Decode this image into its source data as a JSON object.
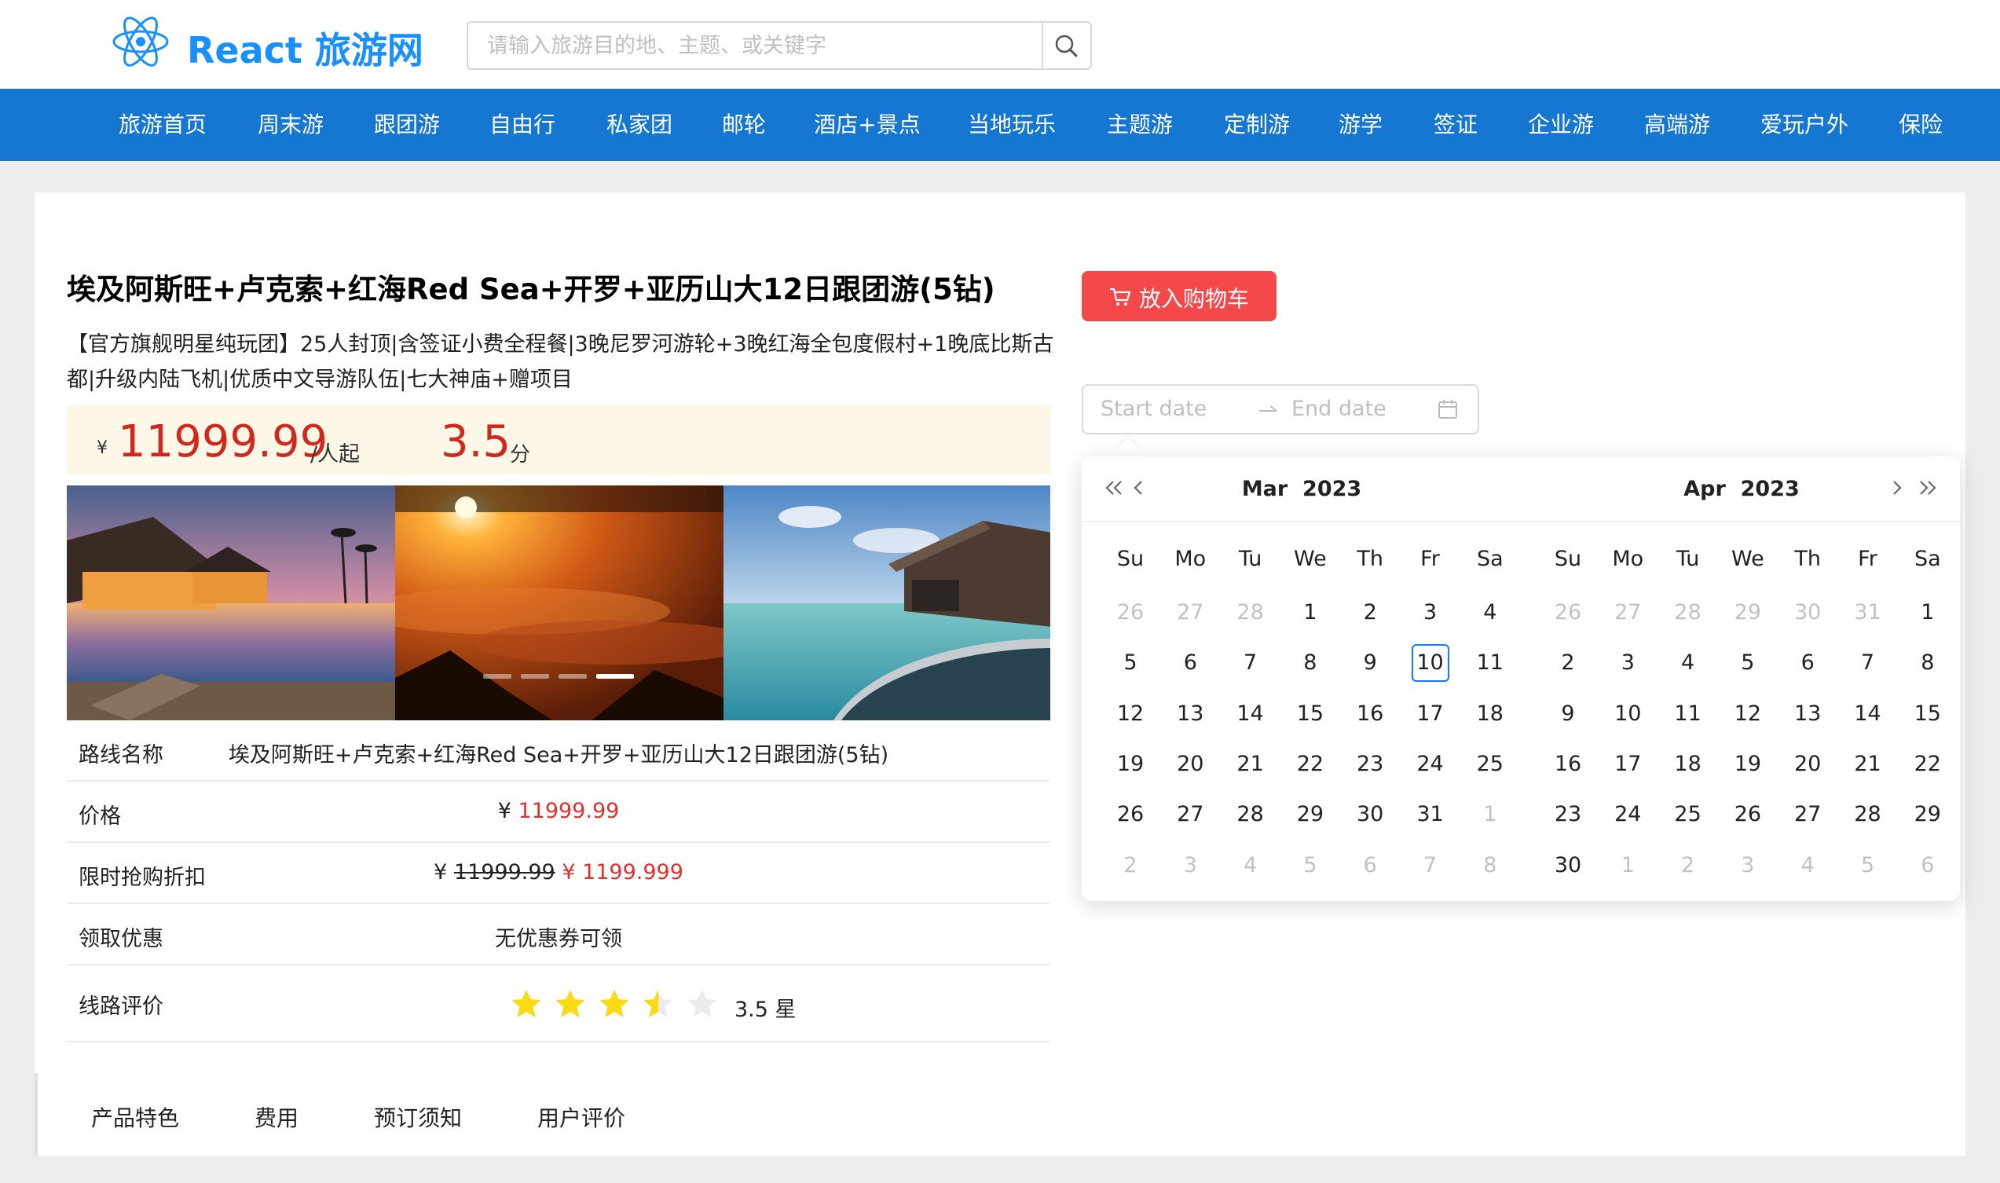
{
  "header": {
    "logo_icon": "react-logo-icon",
    "title": "React 旅游网",
    "search_placeholder": "请输入旅游目的地、主题、或关键字",
    "search_icon": "search-icon"
  },
  "nav": [
    "旅游首页",
    "周末游",
    "跟团游",
    "自由行",
    "私家团",
    "邮轮",
    "酒店+景点",
    "当地玩乐",
    "主题游",
    "定制游",
    "游学",
    "签证",
    "企业游",
    "高端游",
    "爱玩户外",
    "保险"
  ],
  "product": {
    "title": "埃及阿斯旺+卢克索+红海Red Sea+开罗+亚历山大12日跟团游(5钻)",
    "subtitle": "【官方旗舰明星纯玩团】25人封顶|含签证小费全程餐|3晚尼罗河游轮+3晚红海全包度假村+1晚底比斯古都|升级内陆飞机|优质中文导游队伍|七大神庙+赠项目",
    "currency": "¥",
    "price": "11999.99",
    "price_unit": "/人起",
    "rating": "3.5",
    "rating_unit": "分",
    "carousel_active_index": 3,
    "carousel_slide_count": 4
  },
  "info": {
    "route_label": "路线名称",
    "route_value": "埃及阿斯旺+卢克索+红海Red Sea+开罗+亚历山大12日跟团游(5钻)",
    "price_label": "价格",
    "price_cur": "¥",
    "price_value": "11999.99",
    "discount_label": "限时抢购折扣",
    "discount_cur": "¥",
    "discount_original": "11999.99",
    "discount_price": "¥ 1199.999",
    "coupon_label": "领取优惠",
    "coupon_value": "无优惠券可领",
    "review_label": "线路评价",
    "review_stars": 3.5,
    "review_value": "3.5 星"
  },
  "tabs": [
    "产品特色",
    "费用",
    "预订须知",
    "用户评价"
  ],
  "cart_button": {
    "label": "放入购物车",
    "icon": "shopping-cart-icon"
  },
  "date_range": {
    "start_placeholder": "Start date",
    "end_placeholder": "End date"
  },
  "calendar": {
    "left": {
      "month": "Mar",
      "year": "2023",
      "weekdays": [
        "Su",
        "Mo",
        "Tu",
        "We",
        "Th",
        "Fr",
        "Sa"
      ],
      "today": "10",
      "weeks": [
        [
          "26",
          "27",
          "28",
          "1",
          "2",
          "3",
          "4"
        ],
        [
          "5",
          "6",
          "7",
          "8",
          "9",
          "10",
          "11"
        ],
        [
          "12",
          "13",
          "14",
          "15",
          "16",
          "17",
          "18"
        ],
        [
          "19",
          "20",
          "21",
          "22",
          "23",
          "24",
          "25"
        ],
        [
          "26",
          "27",
          "28",
          "29",
          "30",
          "31",
          "1"
        ],
        [
          "2",
          "3",
          "4",
          "5",
          "6",
          "7",
          "8"
        ]
      ]
    },
    "right": {
      "month": "Apr",
      "year": "2023",
      "weekdays": [
        "Su",
        "Mo",
        "Tu",
        "We",
        "Th",
        "Fr",
        "Sa"
      ],
      "weeks": [
        [
          "26",
          "27",
          "28",
          "29",
          "30",
          "31",
          "1"
        ],
        [
          "2",
          "3",
          "4",
          "5",
          "6",
          "7",
          "8"
        ],
        [
          "9",
          "10",
          "11",
          "12",
          "13",
          "14",
          "15"
        ],
        [
          "16",
          "17",
          "18",
          "19",
          "20",
          "21",
          "22"
        ],
        [
          "23",
          "24",
          "25",
          "26",
          "27",
          "28",
          "29"
        ],
        [
          "30",
          "1",
          "2",
          "3",
          "4",
          "5",
          "6"
        ]
      ]
    }
  },
  "colors": {
    "brand": "#1890ff",
    "nav_bg": "#1677d2",
    "price_red": "#d4271c",
    "cart_red": "#f5484a",
    "star": "#fadb14"
  }
}
